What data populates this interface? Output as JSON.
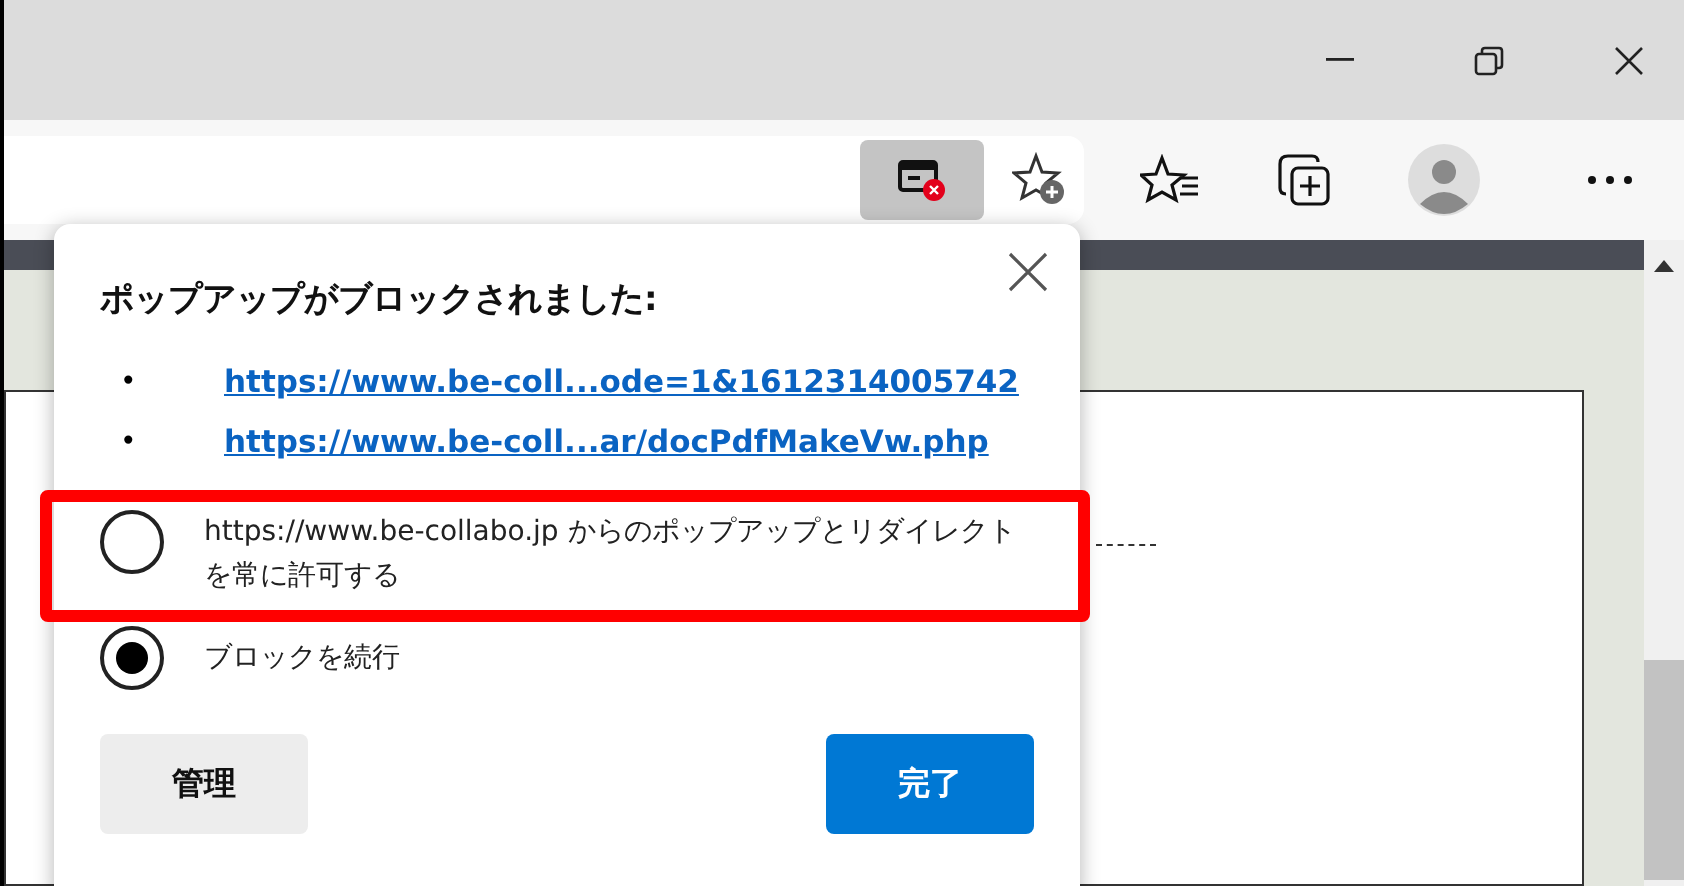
{
  "popup": {
    "title": "ポップアップがブロックされました:",
    "links": [
      {
        "bullet": "•",
        "url": "https://www.be-coll...ode=1&1612314005742"
      },
      {
        "bullet": "•",
        "url": "https://www.be-coll...ar/docPdfMakeVw.php"
      }
    ],
    "options": [
      {
        "label": "https://www.be-collabo.jp からのポップアップとリダイレクトを常に許可する",
        "selected": false,
        "highlighted": true
      },
      {
        "label": "ブロックを続行",
        "selected": true,
        "highlighted": false
      }
    ],
    "buttons": [
      {
        "label": "管理",
        "kind": "secondary"
      },
      {
        "label": "完了",
        "kind": "primary"
      }
    ]
  }
}
